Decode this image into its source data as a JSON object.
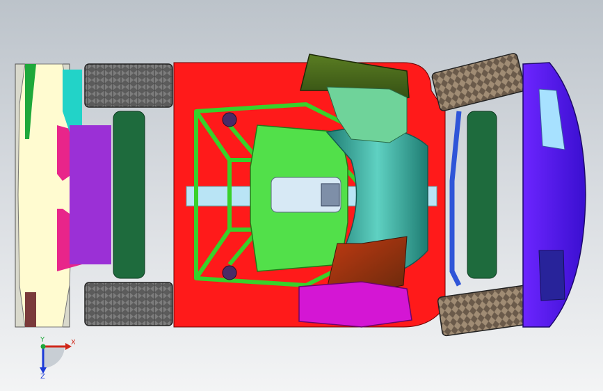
{
  "viewport": {
    "model": "kart-chassis-top-view",
    "colors": {
      "background_top": "#bcc3ca",
      "background_bottom": "#f3f4f5",
      "chassis_plate": "#ff1a1a",
      "roll_cage": "#38d12a",
      "front_nose": "#fffbd0",
      "rear_wing": "#5a17f0",
      "tire": "#4a4a4a",
      "tire_inner": "#1e6b3d",
      "seat_shell": "#2fa69a",
      "side_pod_left": "#3b5b1a",
      "side_pod_right": "#d416d4"
    }
  },
  "triad": {
    "x_label": "X",
    "y_label": "Y",
    "z_label": "Z",
    "colors": {
      "x": "#d0281a",
      "y": "#1ea83a",
      "z": "#1b3ad8"
    }
  }
}
